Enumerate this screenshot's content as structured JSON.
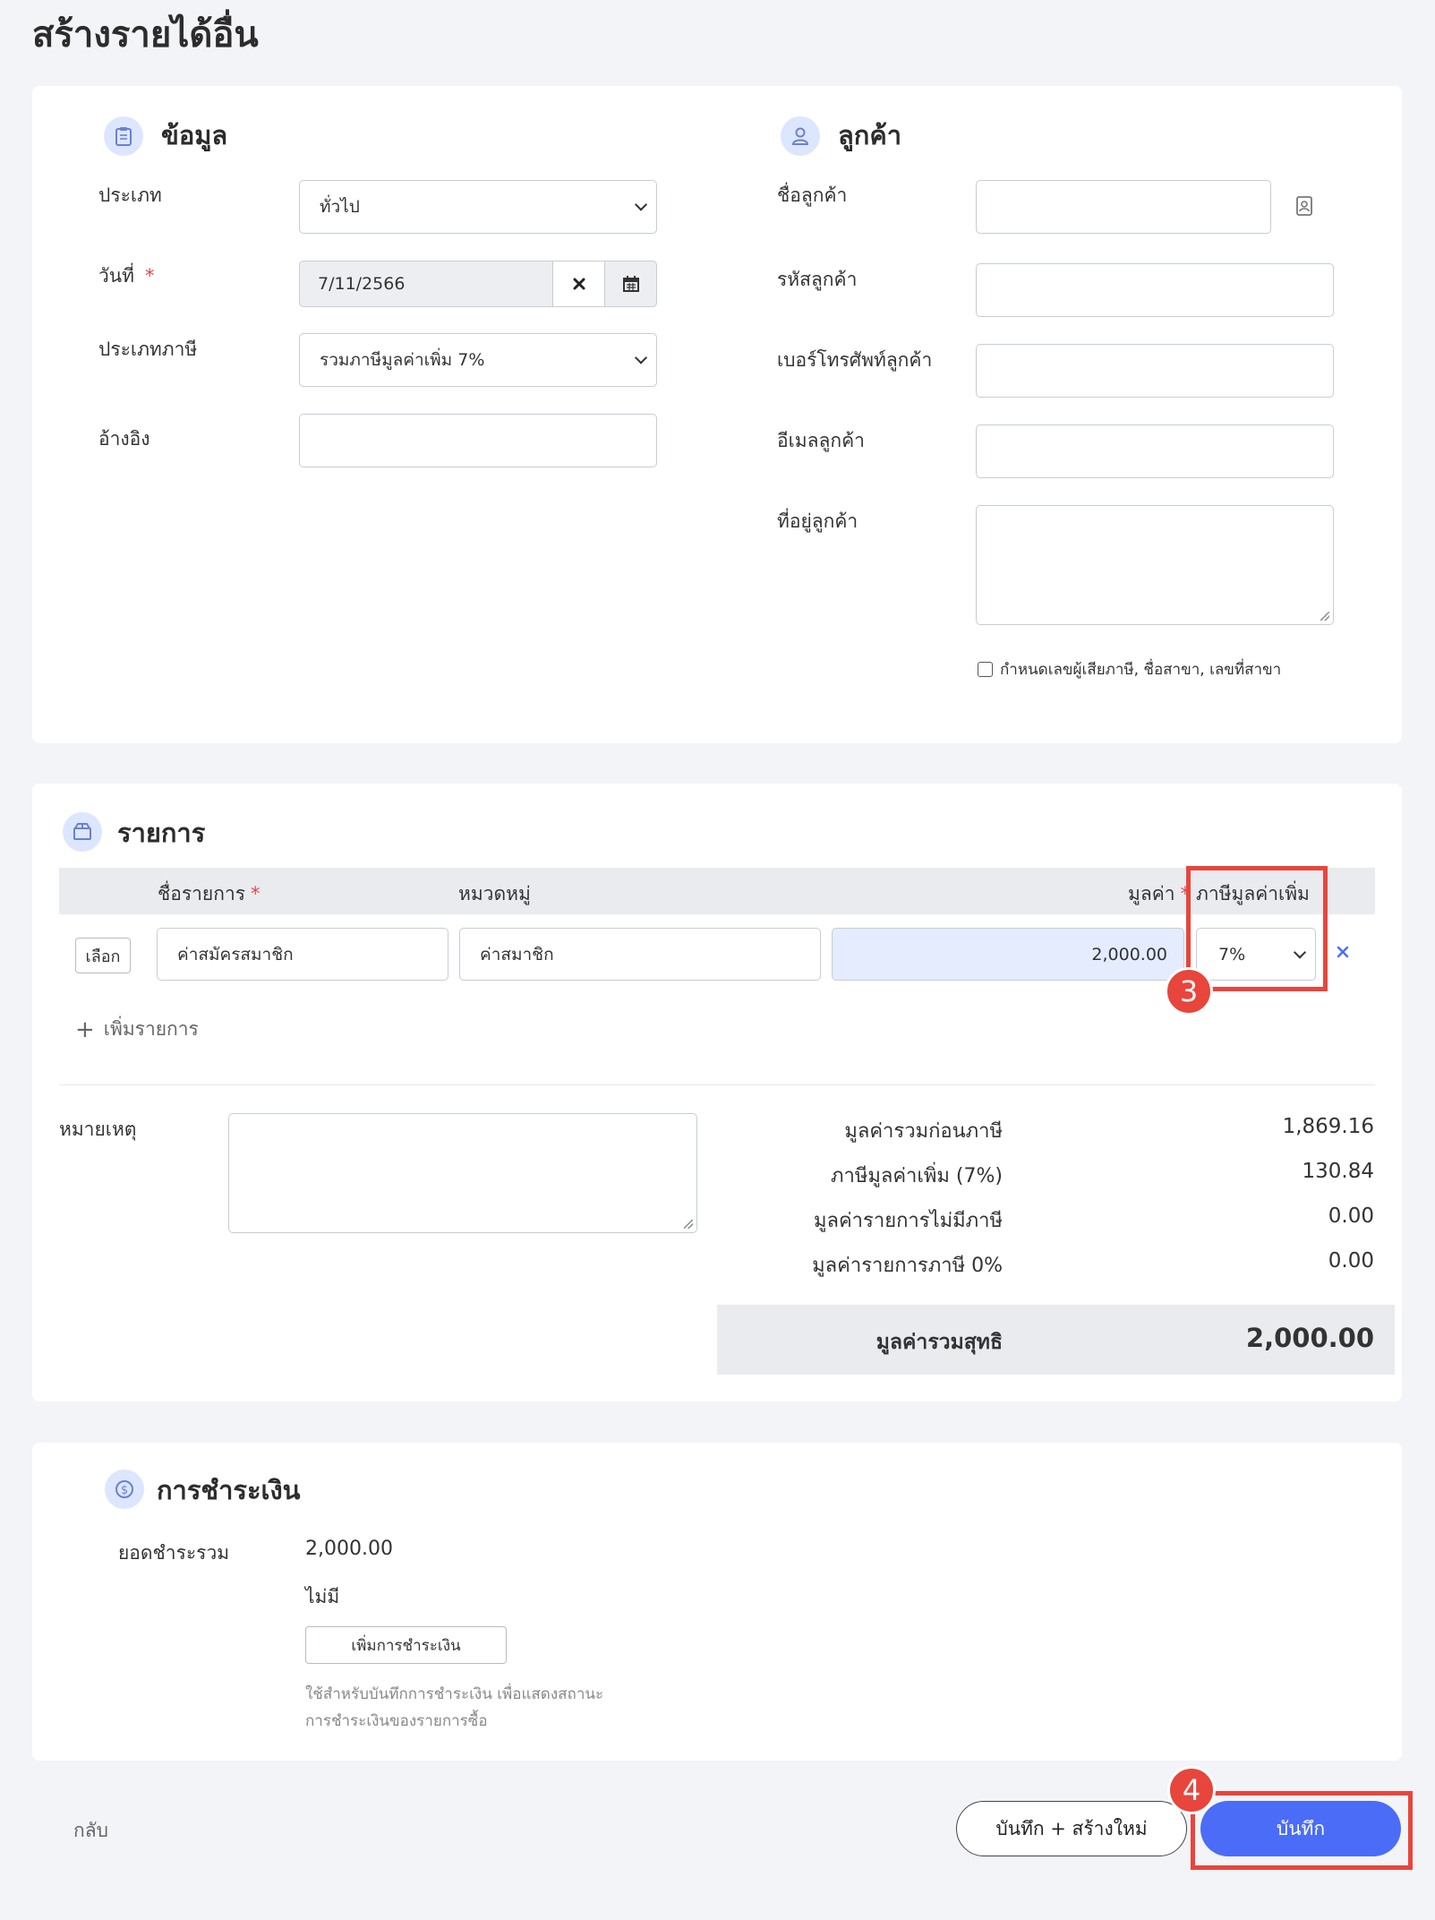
{
  "page": {
    "title": "สร้างรายได้อื่น"
  },
  "info": {
    "title": "ข้อมูล",
    "type_label": "ประเภท",
    "type_value": "ทั่วไป",
    "date_label": "วันที่",
    "required_mark": "*",
    "date_value": "7/11/2566",
    "tax_type_label": "ประเภทภาษี",
    "tax_type_value": "รวมภาษีมูลค่าเพิ่ม 7%",
    "reference_label": "อ้างอิง",
    "reference_value": ""
  },
  "customer": {
    "title": "ลูกค้า",
    "name_label": "ชื่อลูกค้า",
    "code_label": "รหัสลูกค้า",
    "phone_label": "เบอร์โทรศัพท์ลูกค้า",
    "email_label": "อีเมลลูกค้า",
    "address_label": "ที่อยู่ลูกค้า",
    "tax_checkbox_label": "กำหนดเลขผู้เสียภาษี, ชื่อสาขา, เลขที่สาขา"
  },
  "items": {
    "title": "รายการ",
    "headers": {
      "name": "ชื่อรายการ",
      "category": "หมวดหมู่",
      "amount": "มูลค่า",
      "vat": "ภาษีมูลค่าเพิ่ม"
    },
    "required_mark": "*",
    "rows": [
      {
        "select_label": "เลือก",
        "name": "ค่าสมัครสมาชิก",
        "category": "ค่าสมาชิก",
        "amount": "2,000.00",
        "vat": "7%"
      }
    ],
    "add_item_label": "เพิ่มรายการ",
    "note_label": "หมายเหตุ"
  },
  "summary": {
    "subtotal_label": "มูลค่ารวมก่อนภาษี",
    "subtotal_value": "1,869.16",
    "vat_label": "ภาษีมูลค่าเพิ่ม (7%)",
    "vat_value": "130.84",
    "nonvat_label": "มูลค่ารายการไม่มีภาษี",
    "nonvat_value": "0.00",
    "zero_label": "มูลค่ารายการภาษี 0%",
    "zero_value": "0.00",
    "total_label": "มูลค่ารวมสุทธิ",
    "total_value": "2,000.00"
  },
  "payment": {
    "title": "การชำระเงิน",
    "total_label": "ยอดชำระรวม",
    "total_value": "2,000.00",
    "none_text": "ไม่มี",
    "add_button": "เพิ่มการชำระเงิน",
    "help_line1": "ใช้สำหรับบันทึกการชำระเงิน เพื่อแสดงสถานะ",
    "help_line2": "การชำระเงินของรายการซื้อ"
  },
  "footer": {
    "back_label": "กลับ",
    "save_new_label": "บันทึก + สร้างใหม่",
    "save_label": "บันทึก"
  },
  "annotations": {
    "step3": "3",
    "step4": "4"
  },
  "colors": {
    "accent": "#4a6cf7",
    "highlight": "#e8453c",
    "amount_bg": "#e4ecfd"
  }
}
